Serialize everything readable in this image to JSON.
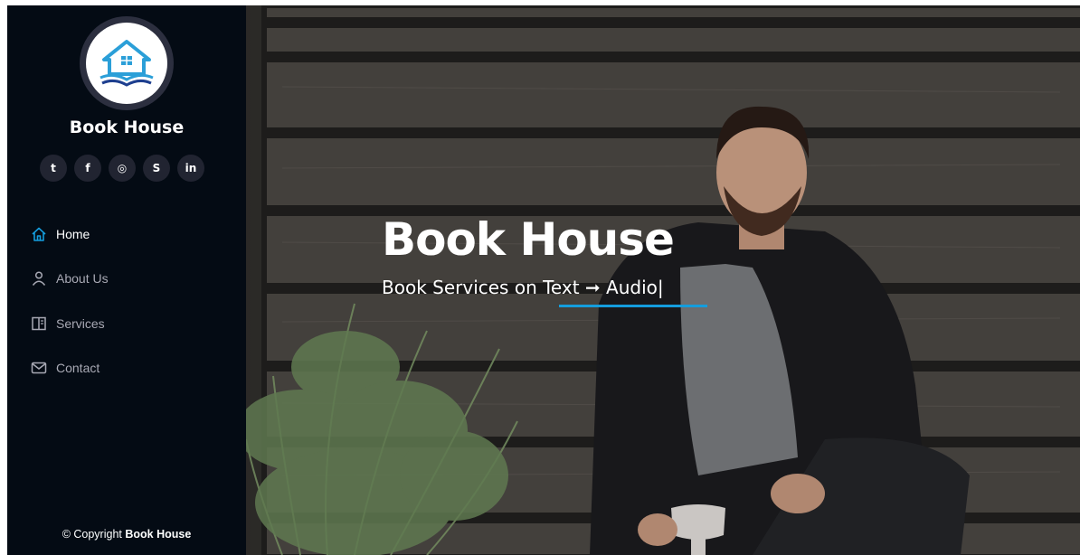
{
  "sidebar": {
    "brand": "Book House",
    "social": [
      {
        "icon": "twitter-icon",
        "glyph": "t"
      },
      {
        "icon": "facebook-icon",
        "glyph": "f"
      },
      {
        "icon": "instagram-icon",
        "glyph": "◎"
      },
      {
        "icon": "skype-icon",
        "glyph": "S"
      },
      {
        "icon": "linkedin-icon",
        "glyph": "in"
      }
    ],
    "nav": [
      {
        "label": "Home",
        "icon": "home-icon",
        "active": true
      },
      {
        "label": "About Us",
        "icon": "user-icon",
        "active": false
      },
      {
        "label": "Services",
        "icon": "book-icon",
        "active": false
      },
      {
        "label": "Contact",
        "icon": "envelope-icon",
        "active": false
      }
    ],
    "copyright_prefix": "© Copyright",
    "copyright_brand": "Book House"
  },
  "hero": {
    "title": "Book House",
    "subtitle": "Book Services on Text ➞ Audio|"
  },
  "colors": {
    "sidebar_bg": "#040b14",
    "accent": "#149ddd",
    "nav_active": "#ffffff",
    "nav_inactive": "#a8a9b4"
  }
}
